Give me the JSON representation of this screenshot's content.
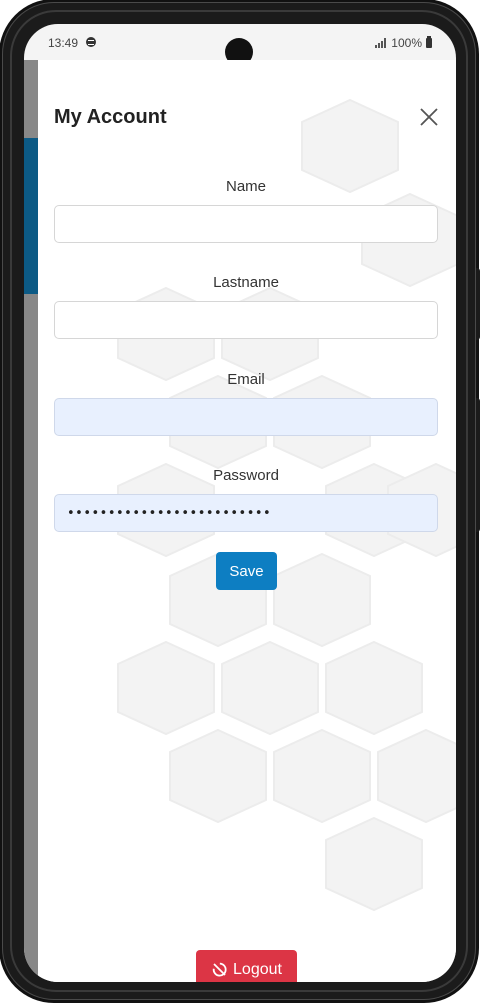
{
  "status_bar": {
    "time": "13:49",
    "battery": "100%",
    "icons": [
      "spotify-icon",
      "signal-icon",
      "battery-icon"
    ]
  },
  "account": {
    "title": "My Account",
    "close_icon": "close-icon",
    "fields": [
      {
        "label": "Name",
        "value": "",
        "placeholder": "",
        "type": "text",
        "autofilled": false
      },
      {
        "label": "Lastname",
        "value": "",
        "placeholder": "",
        "type": "text",
        "autofilled": false
      },
      {
        "label": "Email",
        "value": "",
        "placeholder": "",
        "type": "email",
        "autofilled": true
      },
      {
        "label": "Password",
        "value": "•••••••••••••••••••••••••",
        "placeholder": "",
        "type": "password",
        "autofilled": true
      }
    ],
    "save_label": "Save",
    "logout_label": "Logout",
    "logout_icon": "logout-icon"
  },
  "colors": {
    "primary": "#0d7ec2",
    "danger": "#dc3545",
    "sidebar_accent": "#0c5a85",
    "autofill_bg": "#e8f0fe"
  }
}
